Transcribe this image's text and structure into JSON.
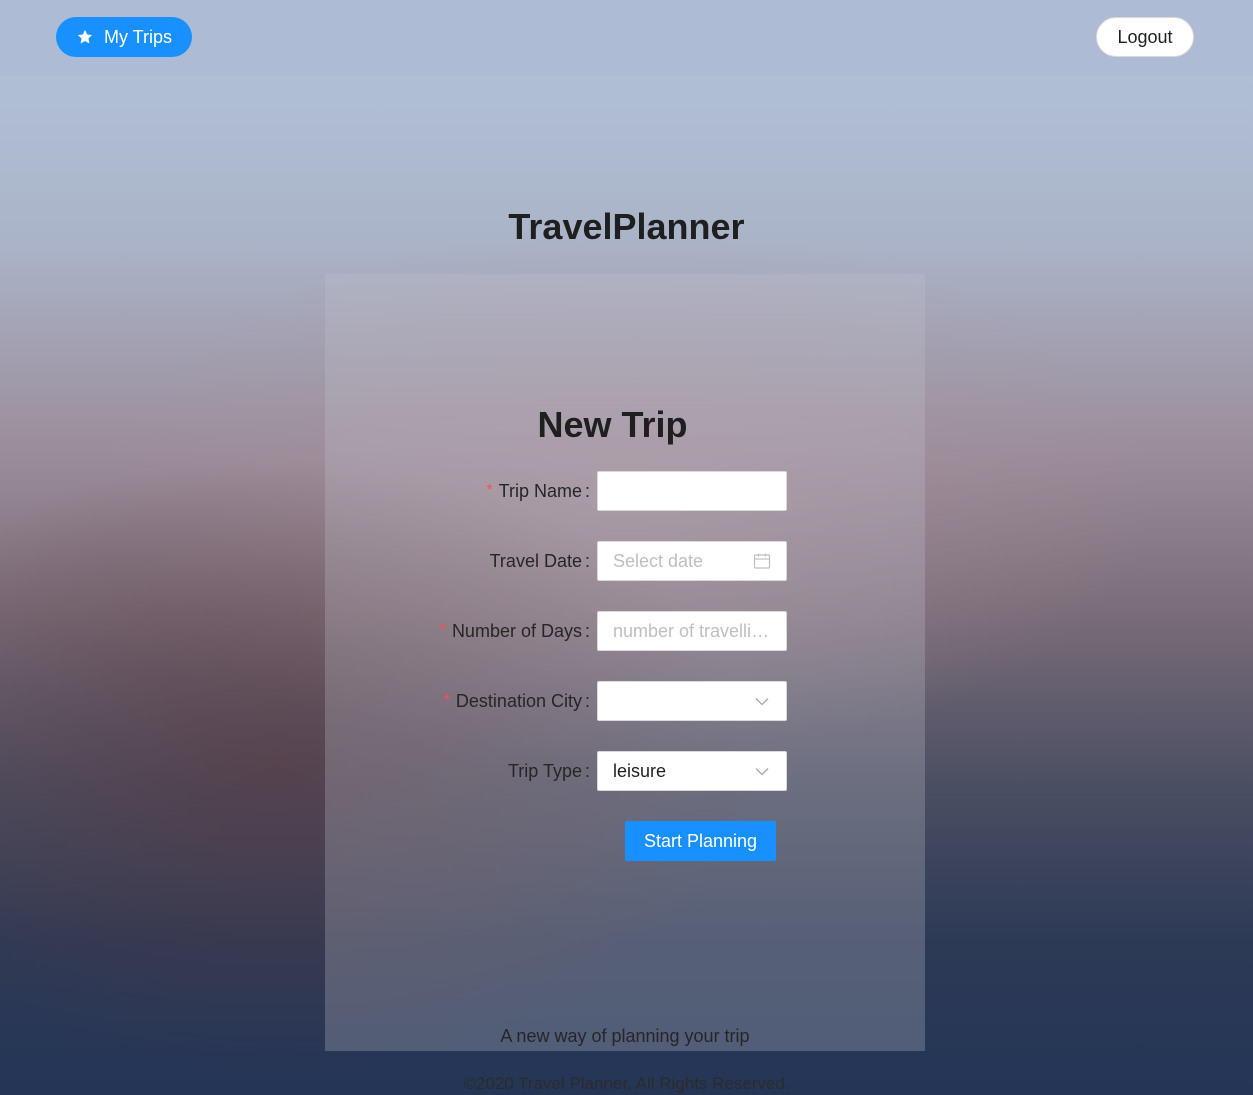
{
  "header": {
    "my_trips_label": "My Trips",
    "my_trips_icon": "star-icon",
    "logout_label": "Logout"
  },
  "app_title": "TravelPlanner",
  "form": {
    "title": "New Trip",
    "fields": [
      {
        "label": "Trip Name",
        "required": true,
        "value": "",
        "placeholder": ""
      },
      {
        "label": "Travel Date",
        "required": false,
        "value": "",
        "placeholder": "Select date",
        "icon": "calendar-icon"
      },
      {
        "label": "Number of Days",
        "required": true,
        "value": "",
        "placeholder": "number of travellin..."
      },
      {
        "label": "Destination City",
        "required": true,
        "value": "",
        "placeholder": "",
        "icon": "chevron-down-icon"
      },
      {
        "label": "Trip Type",
        "required": false,
        "value": "leisure",
        "placeholder": "",
        "icon": "chevron-down-icon"
      }
    ],
    "required_mark": "*",
    "colon": ":",
    "submit_label": "Start Planning"
  },
  "tagline": "A new way of planning your trip",
  "footer": "©2020 Travel Planner. All Rights Reserved.",
  "colors": {
    "primary": "#1890ff",
    "required": "#ff4d4f",
    "placeholder": "#bfbfbf"
  }
}
